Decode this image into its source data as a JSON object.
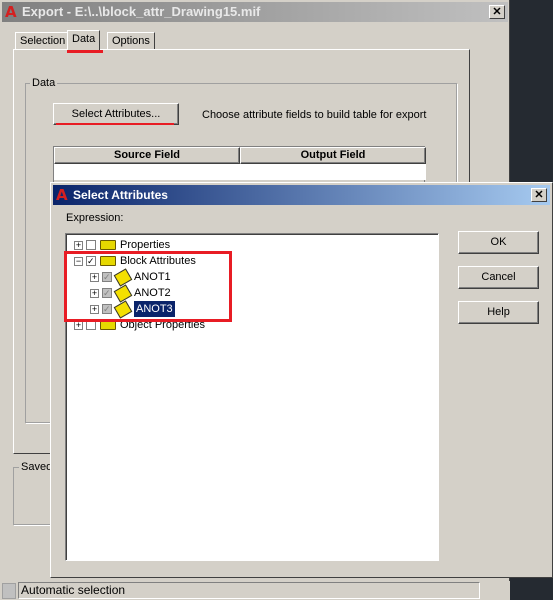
{
  "export_window": {
    "title": "Export - E:\\..\\block_attr_Drawing15.mif",
    "close": "✕",
    "tabs": [
      {
        "label": "Selection"
      },
      {
        "label": "Data",
        "active": true
      },
      {
        "label": "Options"
      }
    ],
    "data_group": {
      "label": "Data",
      "select_button": "Select Attributes...",
      "hint": "Choose attribute fields to build table for export",
      "table_headers": [
        "Source Field",
        "Output Field"
      ]
    },
    "saved_group": {
      "label": "Saved"
    },
    "status": "Automatic selection"
  },
  "select_dialog": {
    "title": "Select Attributes",
    "close": "✕",
    "expression_label": "Expression:",
    "tree": [
      {
        "label": "Properties",
        "level": 0,
        "expander": "+",
        "icon": "folder-icon"
      },
      {
        "label": "Block Attributes",
        "level": 0,
        "expander": "-",
        "icon": "folder-icon",
        "checked": true
      },
      {
        "label": "ANOT1",
        "level": 1,
        "expander": "+",
        "icon": "attribute-icon",
        "checked": true
      },
      {
        "label": "ANOT2",
        "level": 1,
        "expander": "+",
        "icon": "attribute-icon",
        "checked": true
      },
      {
        "label": "ANOT3",
        "level": 1,
        "expander": "+",
        "icon": "attribute-icon",
        "checked": true,
        "selected": true
      },
      {
        "label": "Object Properties",
        "level": 0,
        "expander": "+",
        "icon": "folder-icon"
      }
    ],
    "buttons": {
      "ok": "OK",
      "cancel": "Cancel",
      "help": "Help"
    }
  },
  "colors": {
    "annotation_red": "#e81c24",
    "selection": "#0a246a",
    "title_active": "#0a246a"
  }
}
